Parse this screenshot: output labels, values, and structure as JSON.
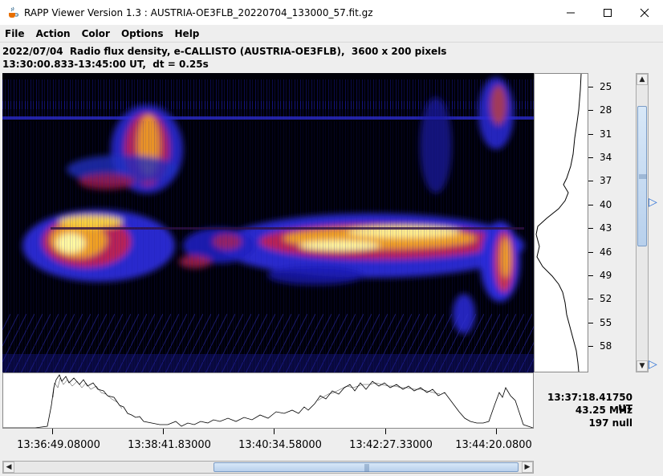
{
  "window": {
    "title": "RAPP Viewer Version 1.3 : AUSTRIA-OE3FLB_20220704_133000_57.fit.gz",
    "controls": {
      "minimize": "—",
      "maximize": "☐",
      "close": "✕"
    }
  },
  "menu": [
    "File",
    "Action",
    "Color",
    "Options",
    "Help"
  ],
  "info": {
    "line1": "2022/07/04  Radio flux density, e-CALLISTO (AUSTRIA-OE3FLB),  3600 x 200 pixels",
    "line2": "13:30:00.833-13:45:00 UT,  dt = 0.25s"
  },
  "freq_axis": {
    "ticks": [
      "25",
      "28",
      "31",
      "34",
      "37",
      "40",
      "43",
      "46",
      "49",
      "52",
      "55",
      "58"
    ]
  },
  "time_axis": {
    "labels": [
      "13:36:49.08000",
      "13:38:41.83000",
      "13:40:34.58000",
      "13:42:27.33000",
      "13:44:20.0800"
    ]
  },
  "readout": {
    "time": "13:37:18.41750 UT",
    "freq": "43.25 MHz",
    "value": "197 null"
  },
  "icons": {
    "app": "java-cup-icon",
    "scroll_up": "▲",
    "scroll_down": "▼",
    "scroll_left": "◀",
    "scroll_right": "▶",
    "pointer": "▷"
  }
}
